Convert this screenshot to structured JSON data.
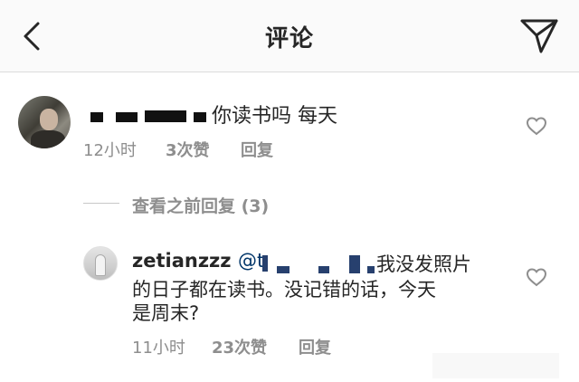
{
  "header": {
    "title": "评论",
    "back_icon": "chevron-left-icon",
    "send_icon": "paper-plane-icon"
  },
  "comment1": {
    "text": "你读书吗 每天",
    "time": "12小时",
    "likes": "3次赞",
    "reply": "回复"
  },
  "view_previous": "查看之前回复 (3)",
  "comment2": {
    "username": "zetianzzz",
    "mention": "@t",
    "text_line1": "我没发照片",
    "text_line2": "的日子都在读书。没记错的话，今天",
    "text_line3": "是周末?",
    "time": "11小时",
    "likes": "23次赞",
    "reply": "回复"
  },
  "colors": {
    "mention_link": "#003569",
    "meta_gray": "#8e8e8e",
    "text": "#262626"
  }
}
